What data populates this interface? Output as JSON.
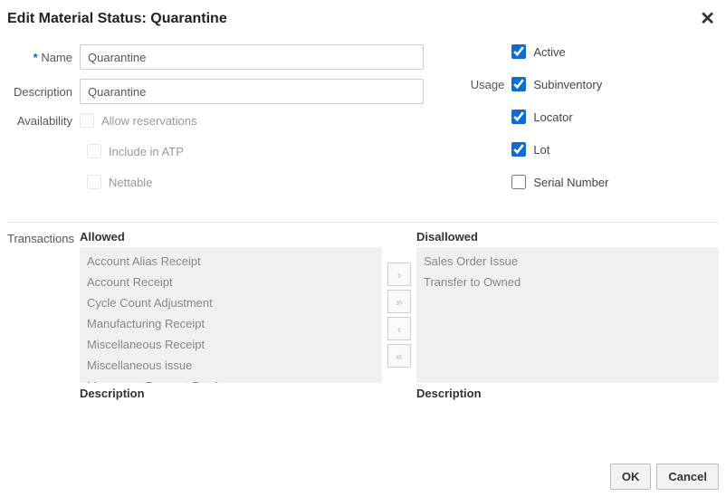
{
  "header": {
    "title": "Edit Material Status: Quarantine"
  },
  "form": {
    "name_label": "Name",
    "name_value": "Quarantine",
    "description_label": "Description",
    "description_value": "Quarantine",
    "availability_label": "Availability",
    "allow_reservations_label": "Allow reservations",
    "allow_reservations_checked": false,
    "include_atp_label": "Include in ATP",
    "include_atp_checked": false,
    "nettable_label": "Nettable",
    "nettable_checked": false,
    "active_label": "Active",
    "active_checked": true,
    "usage_label": "Usage",
    "subinventory_label": "Subinventory",
    "subinventory_checked": true,
    "locator_label": "Locator",
    "locator_checked": true,
    "lot_label": "Lot",
    "lot_checked": true,
    "serial_label": "Serial Number",
    "serial_checked": false
  },
  "transactions": {
    "section_label": "Transactions",
    "allowed_header": "Allowed",
    "disallowed_header": "Disallowed",
    "description_label": "Description",
    "allowed": [
      "Account Alias Receipt",
      "Account Receipt",
      "Cycle Count Adjustment",
      "Manufacturing Receipt",
      "Miscellaneous Receipt",
      "Miscellaneous issue",
      "Movement Request Put Away"
    ],
    "disallowed": [
      "Sales Order Issue",
      "Transfer to Owned"
    ]
  },
  "buttons": {
    "move_right": "›",
    "move_all_right": "»",
    "move_left": "‹",
    "move_all_left": "«",
    "ok": "OK",
    "cancel": "Cancel"
  }
}
